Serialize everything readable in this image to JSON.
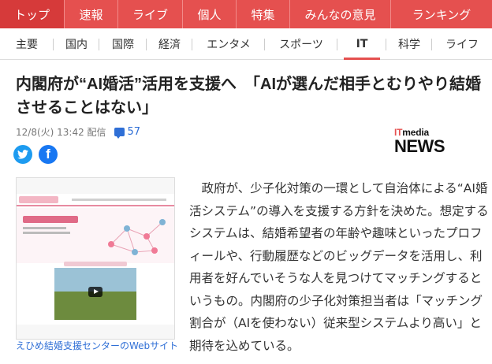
{
  "topnav": {
    "items": [
      {
        "label": "トップ",
        "active": true
      },
      {
        "label": "速報"
      },
      {
        "label": "ライブ"
      },
      {
        "label": "個人"
      },
      {
        "label": "特集"
      },
      {
        "label": "みんなの意見"
      },
      {
        "label": "ランキング"
      }
    ]
  },
  "subnav": {
    "items": [
      {
        "label": "主要"
      },
      {
        "label": "国内"
      },
      {
        "label": "国際"
      },
      {
        "label": "経済"
      },
      {
        "label": "エンタメ"
      },
      {
        "label": "スポーツ"
      },
      {
        "label": "IT",
        "active": true
      },
      {
        "label": "科学"
      },
      {
        "label": "ライフ"
      }
    ]
  },
  "article": {
    "title": "内閣府が“AI婚活”活用を支援へ　「AIが選んだ相手とむりやり結婚させることはない」",
    "date": "12/8(火) 13:42 配信",
    "comment_count": "57",
    "source_logo": {
      "top": "ITmedia",
      "top_accent": "IT",
      "top_rest": "media",
      "bottom": "NEWS"
    },
    "image_caption": "えひめ結婚支援センターのWebサイト",
    "body": "政府が、少子化対策の一環として自治体による“AI婚活システム”の導入を支援する方針を決めた。想定するシステムは、結婚希望者の年齢や趣味といったプロフィールや、行動履歴などのビッグデータを活用し、利用者を好んでいそうな人を見つけてマッチングするというもの。内閣府の少子化対策担当者は「マッチング割合が（AIを使わない）従来型システムより高い」と期待を込めている。"
  },
  "colors": {
    "accent": "#e5504f",
    "link": "#2f6fd6",
    "twitter": "#1d9bf0",
    "facebook": "#1877f2"
  }
}
